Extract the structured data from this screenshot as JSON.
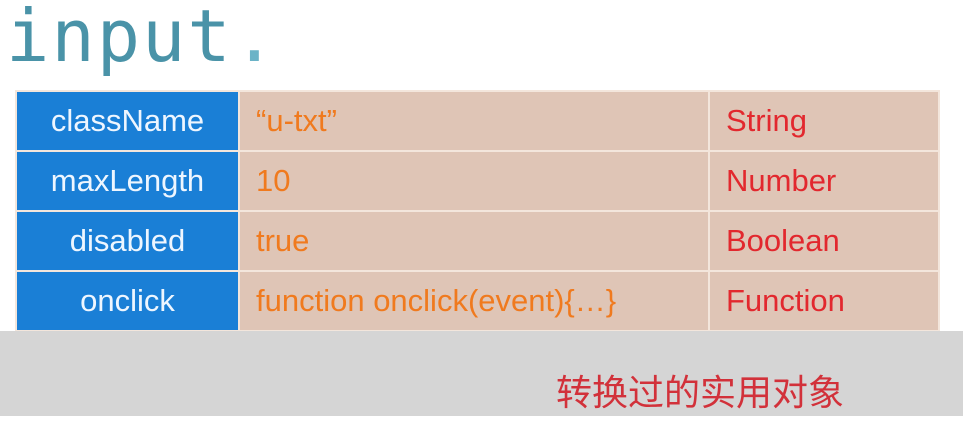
{
  "title": "input",
  "title_dot": ".",
  "rows": [
    {
      "key": "className",
      "value": "“u-txt”",
      "type": "String"
    },
    {
      "key": "maxLength",
      "value": "10",
      "type": "Number"
    },
    {
      "key": "disabled",
      "value": "true",
      "type": "Boolean"
    },
    {
      "key": "onclick",
      "value": "function onclick(event){…}",
      "type": "Function"
    }
  ],
  "caption": "转换过的实用对象"
}
